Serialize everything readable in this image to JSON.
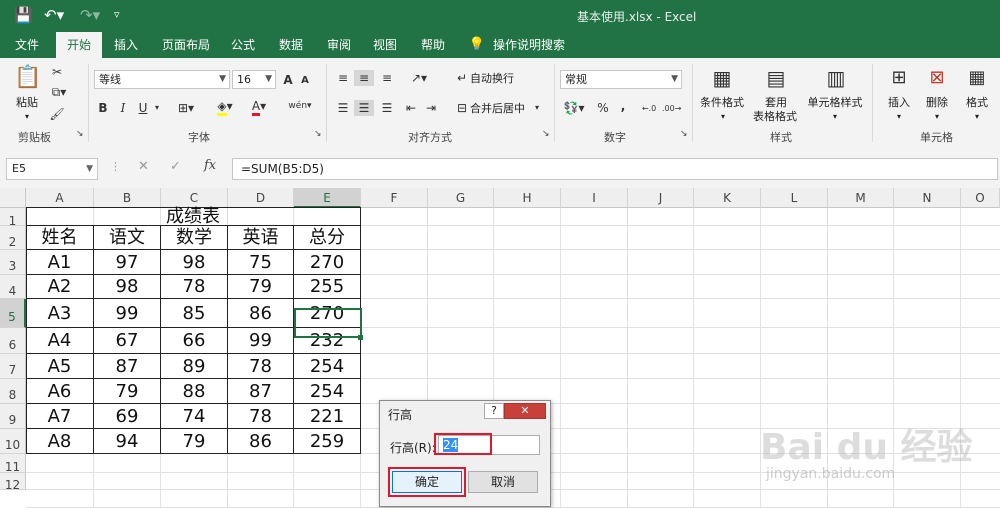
{
  "window": {
    "title": "基本使用.xlsx  -  Excel"
  },
  "tabs": [
    "文件",
    "开始",
    "插入",
    "页面布局",
    "公式",
    "数据",
    "审阅",
    "视图",
    "帮助",
    "操作说明搜索"
  ],
  "ribbon": {
    "clipboard": {
      "label": "剪贴板",
      "paste": "粘贴"
    },
    "font": {
      "label": "字体",
      "name": "等线",
      "size": "16",
      "grow": "A",
      "shrink": "A",
      "bold": "B",
      "italic": "I",
      "underline": "U",
      "phonetic": "wén"
    },
    "alignment": {
      "label": "对齐方式",
      "wrap": "自动换行",
      "merge": "合并后居中"
    },
    "number": {
      "label": "数字",
      "format": "常规",
      "percent": "%",
      "comma": ","
    },
    "styles": {
      "label": "样式",
      "conditional": "条件格式",
      "table": "套用\n表格格式",
      "table_line1": "套用",
      "table_line2": "表格格式",
      "cell_styles": "单元格样式"
    },
    "cells": {
      "label": "单元格",
      "insert": "插入",
      "delete": "删除",
      "format": "格式"
    }
  },
  "formula_bar": {
    "name_box": "E5",
    "fx": "fx",
    "formula": "=SUM(B5:D5)"
  },
  "sheet": {
    "columns": [
      "A",
      "B",
      "C",
      "D",
      "E",
      "F",
      "G",
      "H",
      "I",
      "J",
      "K",
      "L",
      "M",
      "N",
      "O"
    ],
    "rows": [
      "1",
      "2",
      "3",
      "4",
      "5",
      "6",
      "7",
      "8",
      "9",
      "10",
      "11",
      "12"
    ],
    "selected_cell": "E5",
    "table_title": "成绩表",
    "headers": [
      "姓名",
      "语文",
      "数学",
      "英语",
      "总分"
    ],
    "data": [
      [
        "A1",
        "97",
        "98",
        "75",
        "270"
      ],
      [
        "A2",
        "98",
        "78",
        "79",
        "255"
      ],
      [
        "A3",
        "99",
        "85",
        "86",
        "270"
      ],
      [
        "A4",
        "67",
        "66",
        "99",
        "232"
      ],
      [
        "A5",
        "87",
        "89",
        "78",
        "254"
      ],
      [
        "A6",
        "79",
        "88",
        "87",
        "254"
      ],
      [
        "A7",
        "69",
        "74",
        "78",
        "221"
      ],
      [
        "A8",
        "94",
        "79",
        "86",
        "259"
      ]
    ]
  },
  "dialog": {
    "title": "行高",
    "help": "?",
    "close": "✕",
    "field_label": "行高(R):",
    "value": "24",
    "ok": "确定",
    "cancel": "取消"
  },
  "watermark": {
    "brand": "Bai du 经验",
    "url": "jingyan.baidu.com"
  },
  "colors": {
    "excel_green": "#217346",
    "highlight_red": "#e0182d"
  }
}
